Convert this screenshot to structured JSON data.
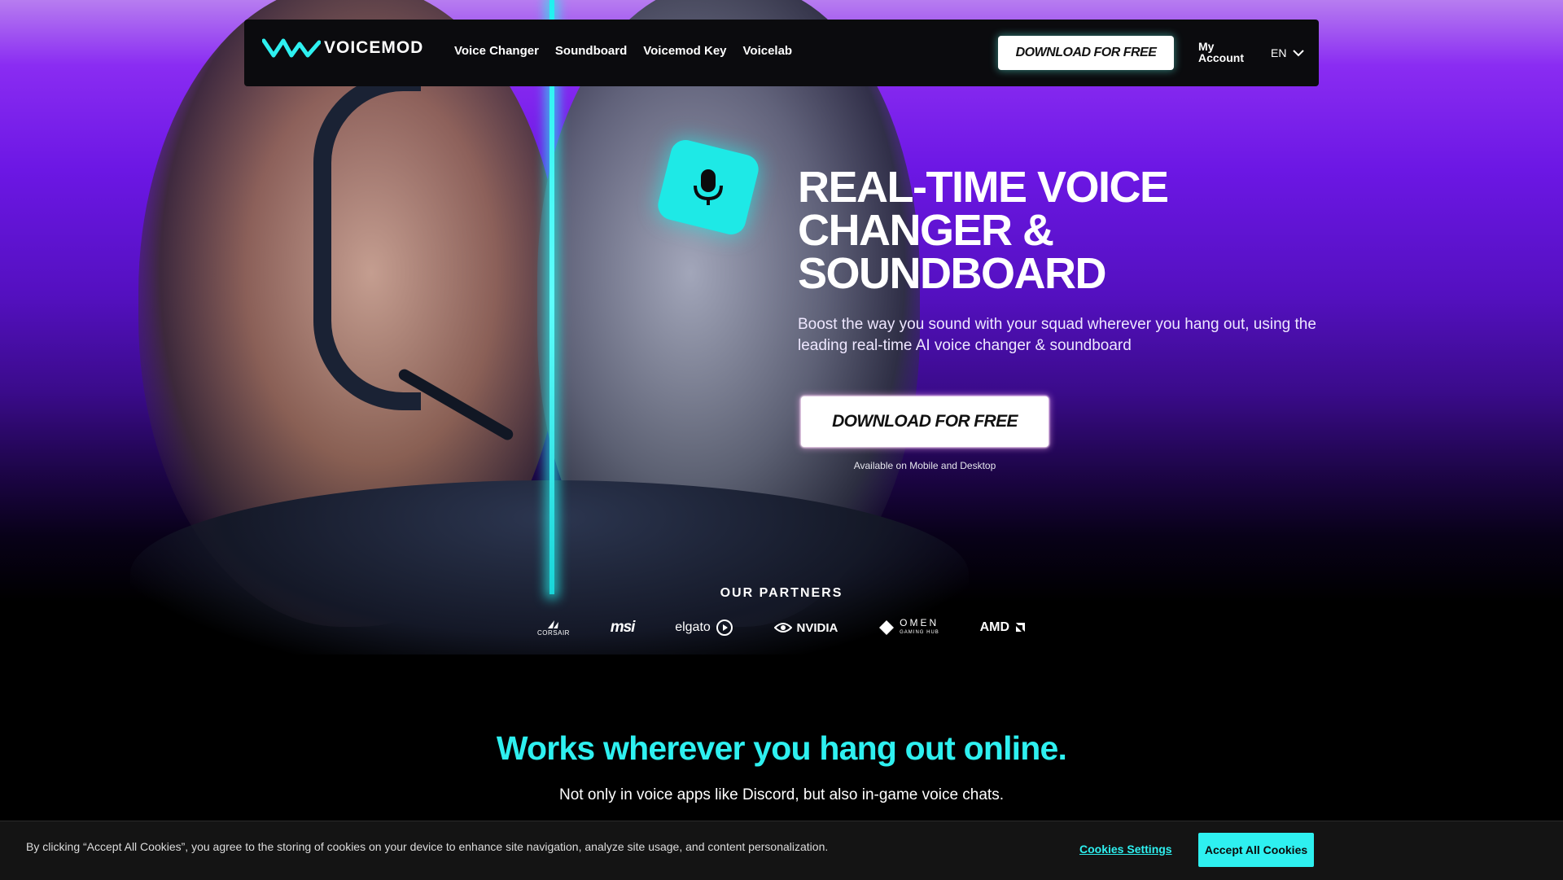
{
  "nav": {
    "logo_text": "VOICEMOD",
    "links": [
      "Voice Changer",
      "Soundboard",
      "Voicemod Key",
      "Voicelab"
    ],
    "download_label": "DOWNLOAD FOR FREE",
    "account_label": "My Account",
    "language": "EN"
  },
  "hero": {
    "title": "REAL-TIME VOICE CHANGER & SOUNDBOARD",
    "subtitle": "Boost the way you sound with your squad wherever you hang out, using the leading real-time AI voice changer & soundboard",
    "cta_label": "DOWNLOAD FOR FREE",
    "cta_note": "Available on Mobile and Desktop"
  },
  "partners": {
    "title": "OUR PARTNERS",
    "logos": [
      "CORSAIR",
      "msi",
      "elgato",
      "NVIDIA",
      "OMEN",
      "AMD"
    ],
    "omen_tagline": "GAMING HUB"
  },
  "section": {
    "title": "Works wherever you hang out online.",
    "subtitle": "Not only in voice apps like Discord, but also in-game voice chats."
  },
  "cookies": {
    "text": "By clicking “Accept All Cookies”, you agree to the storing of cookies on your device to enhance site navigation, analyze site usage, and content personalization.",
    "settings_label": "Cookies Settings",
    "accept_label": "Accept All Cookies"
  },
  "colors": {
    "accent": "#2ef0f0",
    "hero_purple": "#6c17e4",
    "nav_background": "#0b0b0e"
  }
}
